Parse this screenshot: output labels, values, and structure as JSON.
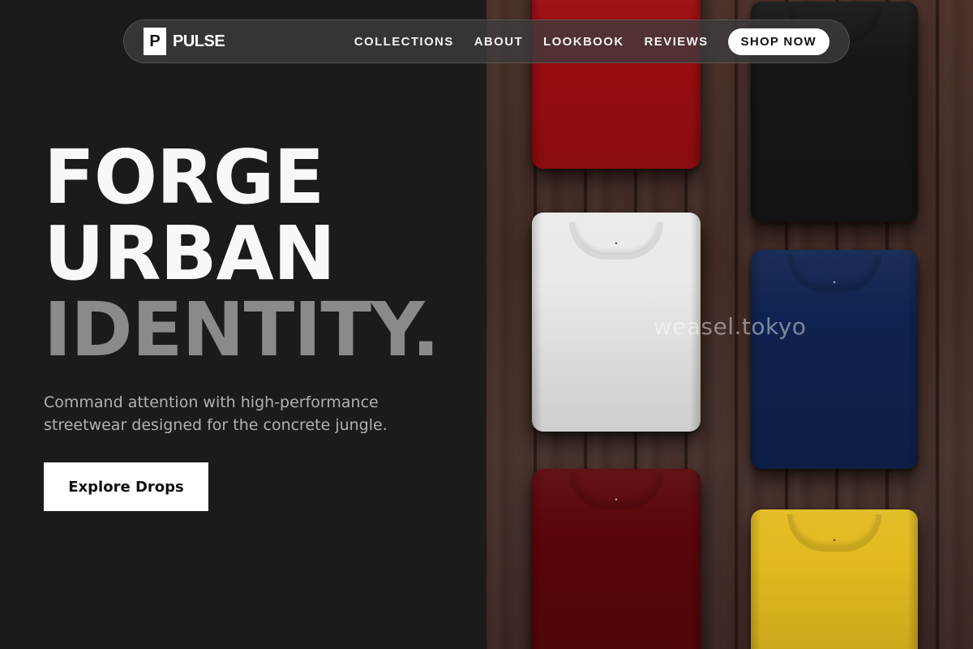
{
  "brand": {
    "logo_letter": "P",
    "name": "PULSE"
  },
  "nav": {
    "links": [
      "COLLECTIONS",
      "ABOUT",
      "LOOKBOOK",
      "REVIEWS"
    ],
    "cta_label": "SHOP NOW"
  },
  "hero": {
    "headline": [
      "FORGE",
      "URBAN",
      "IDENTITY."
    ],
    "subtext": "Command attention with high-performance streetwear designed for the concrete jungle.",
    "button_label": "Explore Drops"
  },
  "image": {
    "watermark": "weasel.tokyo",
    "shirt_colors": [
      "#9c0d10",
      "#151515",
      "#eaeaea",
      "#0f2350",
      "#5a060b",
      "#e2ba1f"
    ]
  },
  "colors": {
    "background": "#1b1b1c",
    "headline": "#f8f8f8",
    "headline_muted": "#8a8a8a",
    "subtext": "#b2b2b2",
    "button_bg": "#ffffff"
  }
}
